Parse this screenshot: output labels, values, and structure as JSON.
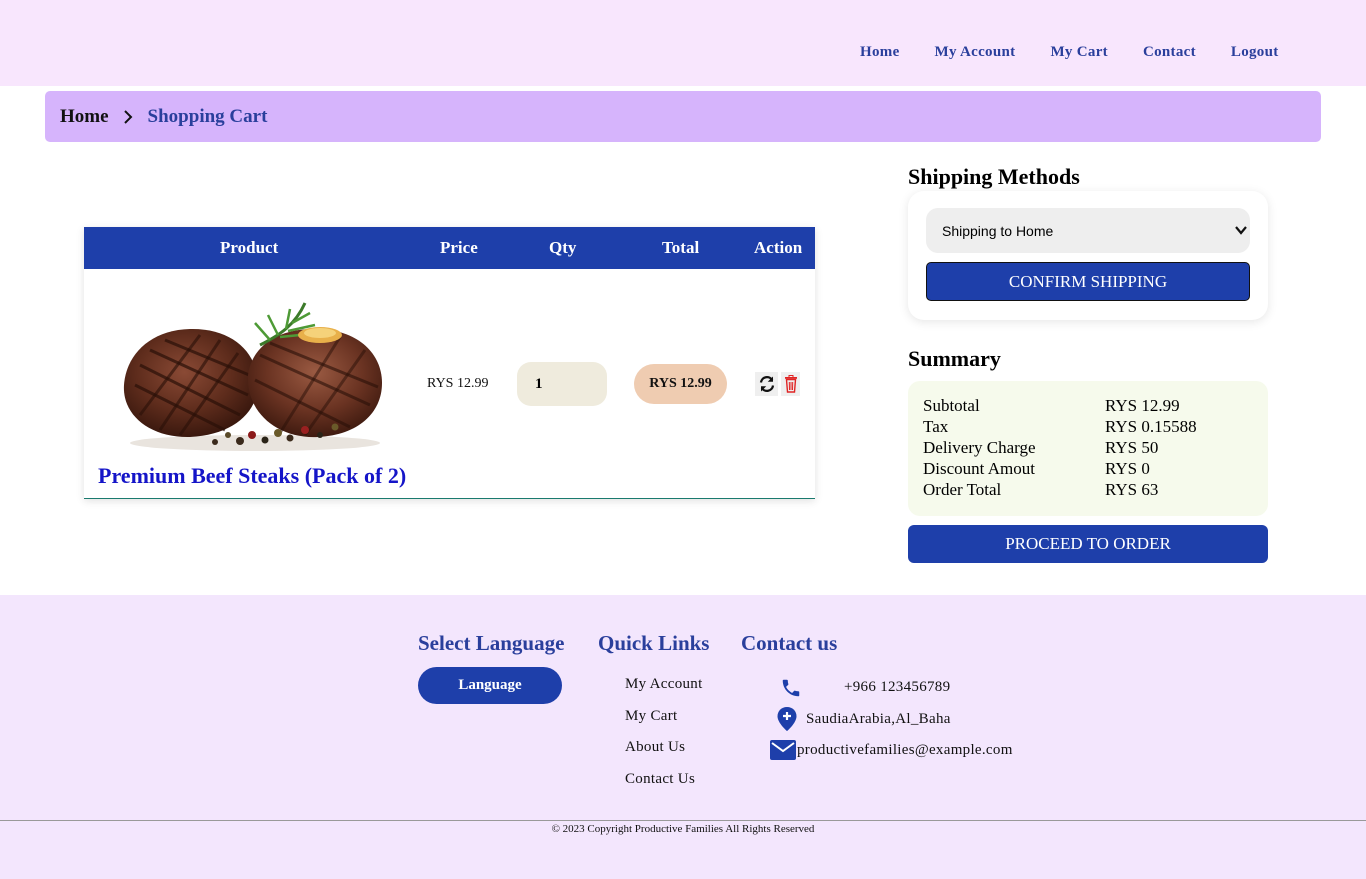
{
  "nav": {
    "items": [
      "Home",
      "My Account",
      "My Cart",
      "Contact",
      "Logout"
    ]
  },
  "breadcrumb": {
    "home": "Home",
    "current": "Shopping Cart"
  },
  "cart": {
    "columns": [
      "Product",
      "Price",
      "Qty",
      "Total",
      "Action"
    ],
    "items": [
      {
        "name": "Premium Beef Steaks (Pack of 2)",
        "price": "RYS 12.99",
        "qty": "1",
        "total": "RYS 12.99",
        "image": "grilled beef steaks with rosemary and peppercorns"
      }
    ],
    "action_icons": [
      "refresh-icon",
      "trash-icon"
    ]
  },
  "shipping": {
    "title": "Shipping Methods",
    "selected": "Shipping to Home",
    "confirm_label": "CONFIRM SHIPPING"
  },
  "summary": {
    "title": "Summary",
    "rows": [
      {
        "label": "Subtotal",
        "value": "RYS 12.99"
      },
      {
        "label": "Tax",
        "value": "RYS 0.15588"
      },
      {
        "label": "Delivery Charge",
        "value": "RYS 50"
      },
      {
        "label": "Discount Amout",
        "value": "RYS 0"
      },
      {
        "label": "Order Total",
        "value": "RYS 63"
      }
    ],
    "proceed_label": "PROCEED TO ORDER"
  },
  "footer": {
    "language": {
      "title": "Select Language",
      "button": "Language"
    },
    "quick_links": {
      "title": "Quick Links",
      "items": [
        "My Account",
        "My Cart",
        "About Us",
        "Contact Us"
      ]
    },
    "contact": {
      "title": "Contact us",
      "phone": "+966 123456789",
      "address": "SaudiaArabia,Al_Baha",
      "email": "productivefamilies@example.com"
    },
    "copyright": "© 2023 Copyright Productive Families All Rights Reserved"
  },
  "colors": {
    "primary": "#1e3faa",
    "header_bg": "#f8e6fd",
    "breadcrumb_bg": "#d6b4fc",
    "footer_bg": "#f3e6fd",
    "summary_bg": "#f6faec",
    "total_pill": "#efccb1",
    "qty_bg": "#efebdd",
    "delete": "#e02424"
  }
}
